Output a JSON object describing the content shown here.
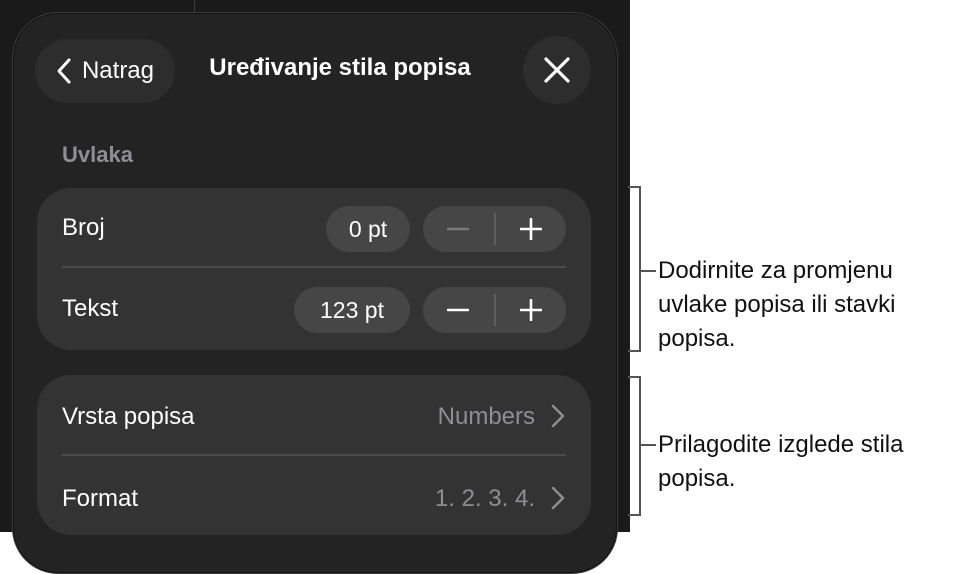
{
  "header": {
    "back_label": "Natrag",
    "title": "Uređivanje stila popisa"
  },
  "indent": {
    "section_label": "Uvlaka",
    "rows": [
      {
        "label": "Broj",
        "value": "0 pt",
        "minus_enabled": false
      },
      {
        "label": "Tekst",
        "value": "123 pt",
        "minus_enabled": true
      }
    ]
  },
  "list": {
    "rows": [
      {
        "label": "Vrsta popisa",
        "value": "Numbers"
      },
      {
        "label": "Format",
        "value": "1. 2. 3. 4."
      }
    ]
  },
  "callouts": [
    "Dodirnite za promjenu uvlake popisa ili stavki popisa.",
    "Prilagodite izglede stila popisa."
  ],
  "colors": {
    "panel": "#232323",
    "group": "#333333",
    "control": "#464646",
    "secondary_text": "#8e8e93",
    "disabled_icon": "#7a7a7a"
  },
  "icons": [
    "chevron-left-icon",
    "close-icon",
    "minus-icon",
    "plus-icon",
    "chevron-right-icon"
  ]
}
